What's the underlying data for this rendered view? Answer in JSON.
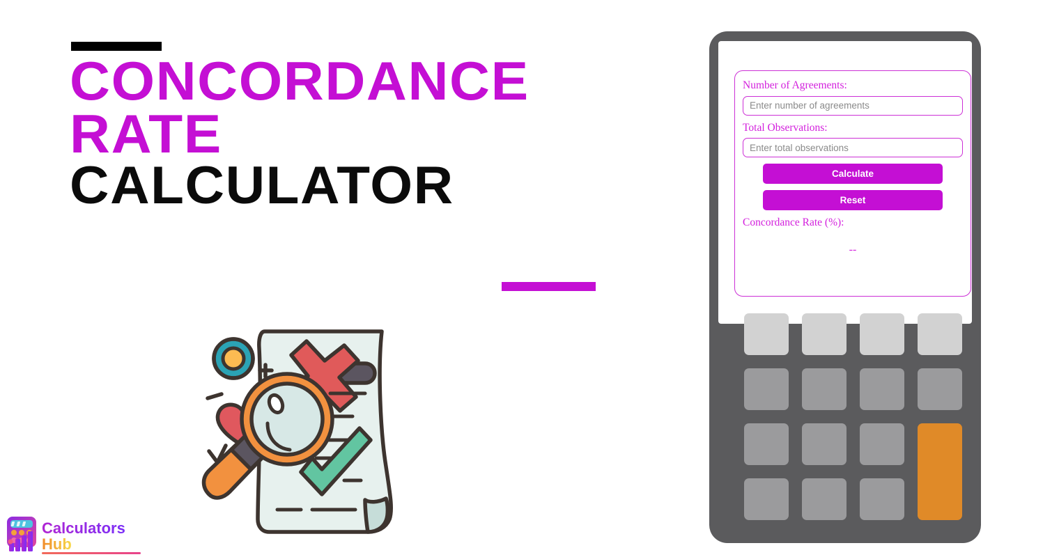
{
  "page": {
    "background": "#ffffff",
    "accent_magenta": "#c40fd4",
    "accent_black": "#000000"
  },
  "hero": {
    "title_lines": [
      {
        "text": "CONCORDANCE",
        "color": "#c40fd4"
      },
      {
        "text": "RATE",
        "color": "#c40fd4"
      },
      {
        "text": "CALCULATOR",
        "color": "#0b0b0b"
      }
    ],
    "rule_top_color": "#000000",
    "rule_bottom_color": "#c40fd4"
  },
  "illustration": {
    "name": "document-review-illustration",
    "elements": [
      "scroll-document",
      "red-cross-mark",
      "green-check-mark",
      "magnifying-glass",
      "heart-shape",
      "target-circle",
      "plus-mark",
      "dash-marks"
    ],
    "colors": {
      "paper": "#e7f1ee",
      "paper_fold": "#c6ddd9",
      "outline": "#3d342f",
      "cross_red": "#e05a5a",
      "check_green": "#62c5a1",
      "glass_orange": "#f2913f",
      "glass_lens": "#d7e8e6",
      "handle_grip": "#5b5560",
      "heart_red": "#e0585e",
      "ring_teal": "#2ba3b5",
      "ring_center": "#fcbb52",
      "line_dark": "#4a4450"
    }
  },
  "logo": {
    "name": "calculators-hub-logo",
    "text_primary": "Calculators",
    "text_secondary": "Hub",
    "primary_color": "#9b2fd6",
    "secondary_color": "#f2b234"
  },
  "calculator": {
    "body_color": "#5b5b5d",
    "screen_color": "#ffffff",
    "form": {
      "fields": [
        {
          "label": "Number of Agreements:",
          "placeholder": "Enter number of agreements",
          "value": ""
        },
        {
          "label": "Total Observations:",
          "placeholder": "Enter total observations",
          "value": ""
        }
      ],
      "buttons": [
        {
          "label": "Calculate",
          "name": "calculate-button"
        },
        {
          "label": "Reset",
          "name": "reset-button"
        }
      ],
      "result": {
        "label": "Concordance Rate (%):",
        "value": "--"
      },
      "border_color": "#cc2fd6",
      "label_color": "#d320dd",
      "button_color": "#c40fd4"
    },
    "keypad": {
      "rows": 4,
      "columns": 4,
      "key_color": "#9b9b9d",
      "top_row_color": "#d2d2d2",
      "accent_key_color": "#e08a28",
      "accent_key_position": "bottom-right-tall"
    }
  }
}
